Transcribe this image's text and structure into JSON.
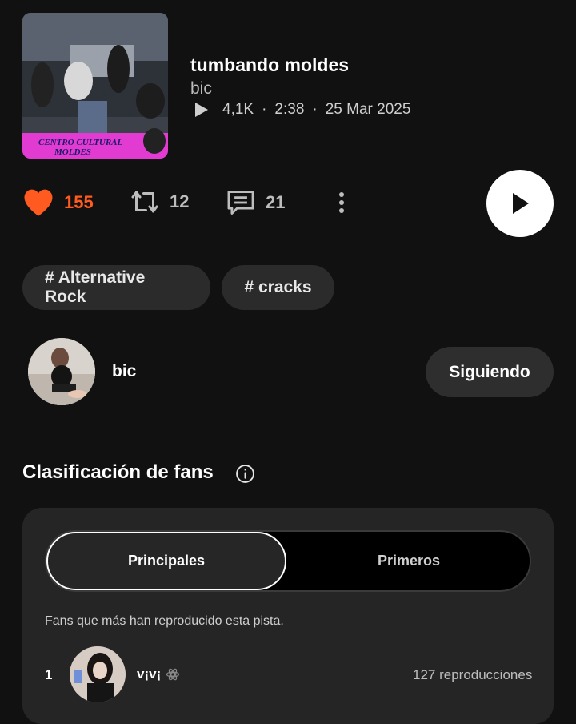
{
  "track": {
    "title": "tumbando moldes",
    "artist": "bic",
    "plays": "4,1K",
    "duration": "2:38",
    "date": "25 Mar 2025",
    "cover_caption_line1": "CENTRO CULTURAL",
    "cover_caption_line2": "MOLDES"
  },
  "actions": {
    "likes": "155",
    "reposts": "12",
    "comments": "21"
  },
  "tags": [
    "# Alternative Rock",
    "# cracks"
  ],
  "uploader": {
    "name": "bic",
    "follow_label": "Siguiendo"
  },
  "fans": {
    "section_title": "Clasificación de fans",
    "tab_top": "Principales",
    "tab_first": "Primeros",
    "description": "Fans que más han reproducido esta pista.",
    "rows": [
      {
        "rank": "1",
        "name": "v¡v¡",
        "plays": "127 reproducciones"
      }
    ]
  },
  "colors": {
    "accent": "#ff5a1f",
    "background": "#111111",
    "card": "#252525"
  },
  "icons": [
    "heart-icon",
    "repost-icon",
    "comment-icon",
    "more-vertical-icon",
    "play-icon",
    "info-icon",
    "badge-icon"
  ]
}
